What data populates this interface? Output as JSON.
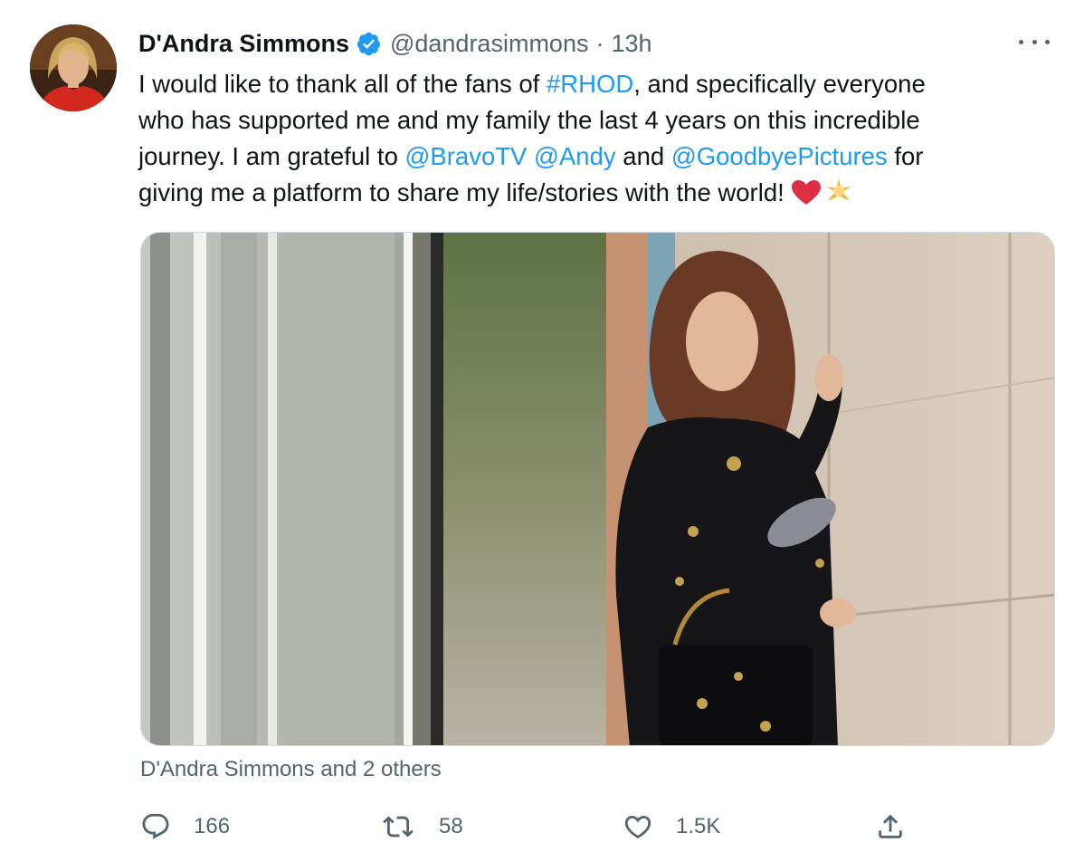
{
  "tweet": {
    "display_name": "D'Andra Simmons",
    "handle": "@dandrasimmons",
    "separator": "·",
    "time": "13h",
    "text": {
      "line1_a": "I would like to thank all of the fans of ",
      "line1_hashtag": "#RHOD",
      "line1_b": ", and specifically everyone",
      "line2": "who has supported me and my family the last 4 years on this incredible",
      "line3_a": "journey. I am grateful to ",
      "mention1": "@BravoTV",
      "mention2": "@Andy",
      "line3_b": " and ",
      "mention3": "@GoodbyePictures",
      "line3_c": " for",
      "line4": "giving me a platform to share my life/stories with the world! "
    },
    "tagged_people": "D'Andra Simmons and 2 others",
    "metrics": {
      "replies": "166",
      "retweets": "58",
      "likes": "1.5K"
    }
  },
  "icons": [
    "verified-badge-icon",
    "more-icon",
    "reply-icon",
    "retweet-icon",
    "like-icon",
    "share-icon",
    "red-heart-emoji",
    "glowing-star-emoji"
  ],
  "colors": {
    "link": "#1d9bf0",
    "secondary_text": "#536471",
    "verified": "#1d9bf0"
  }
}
